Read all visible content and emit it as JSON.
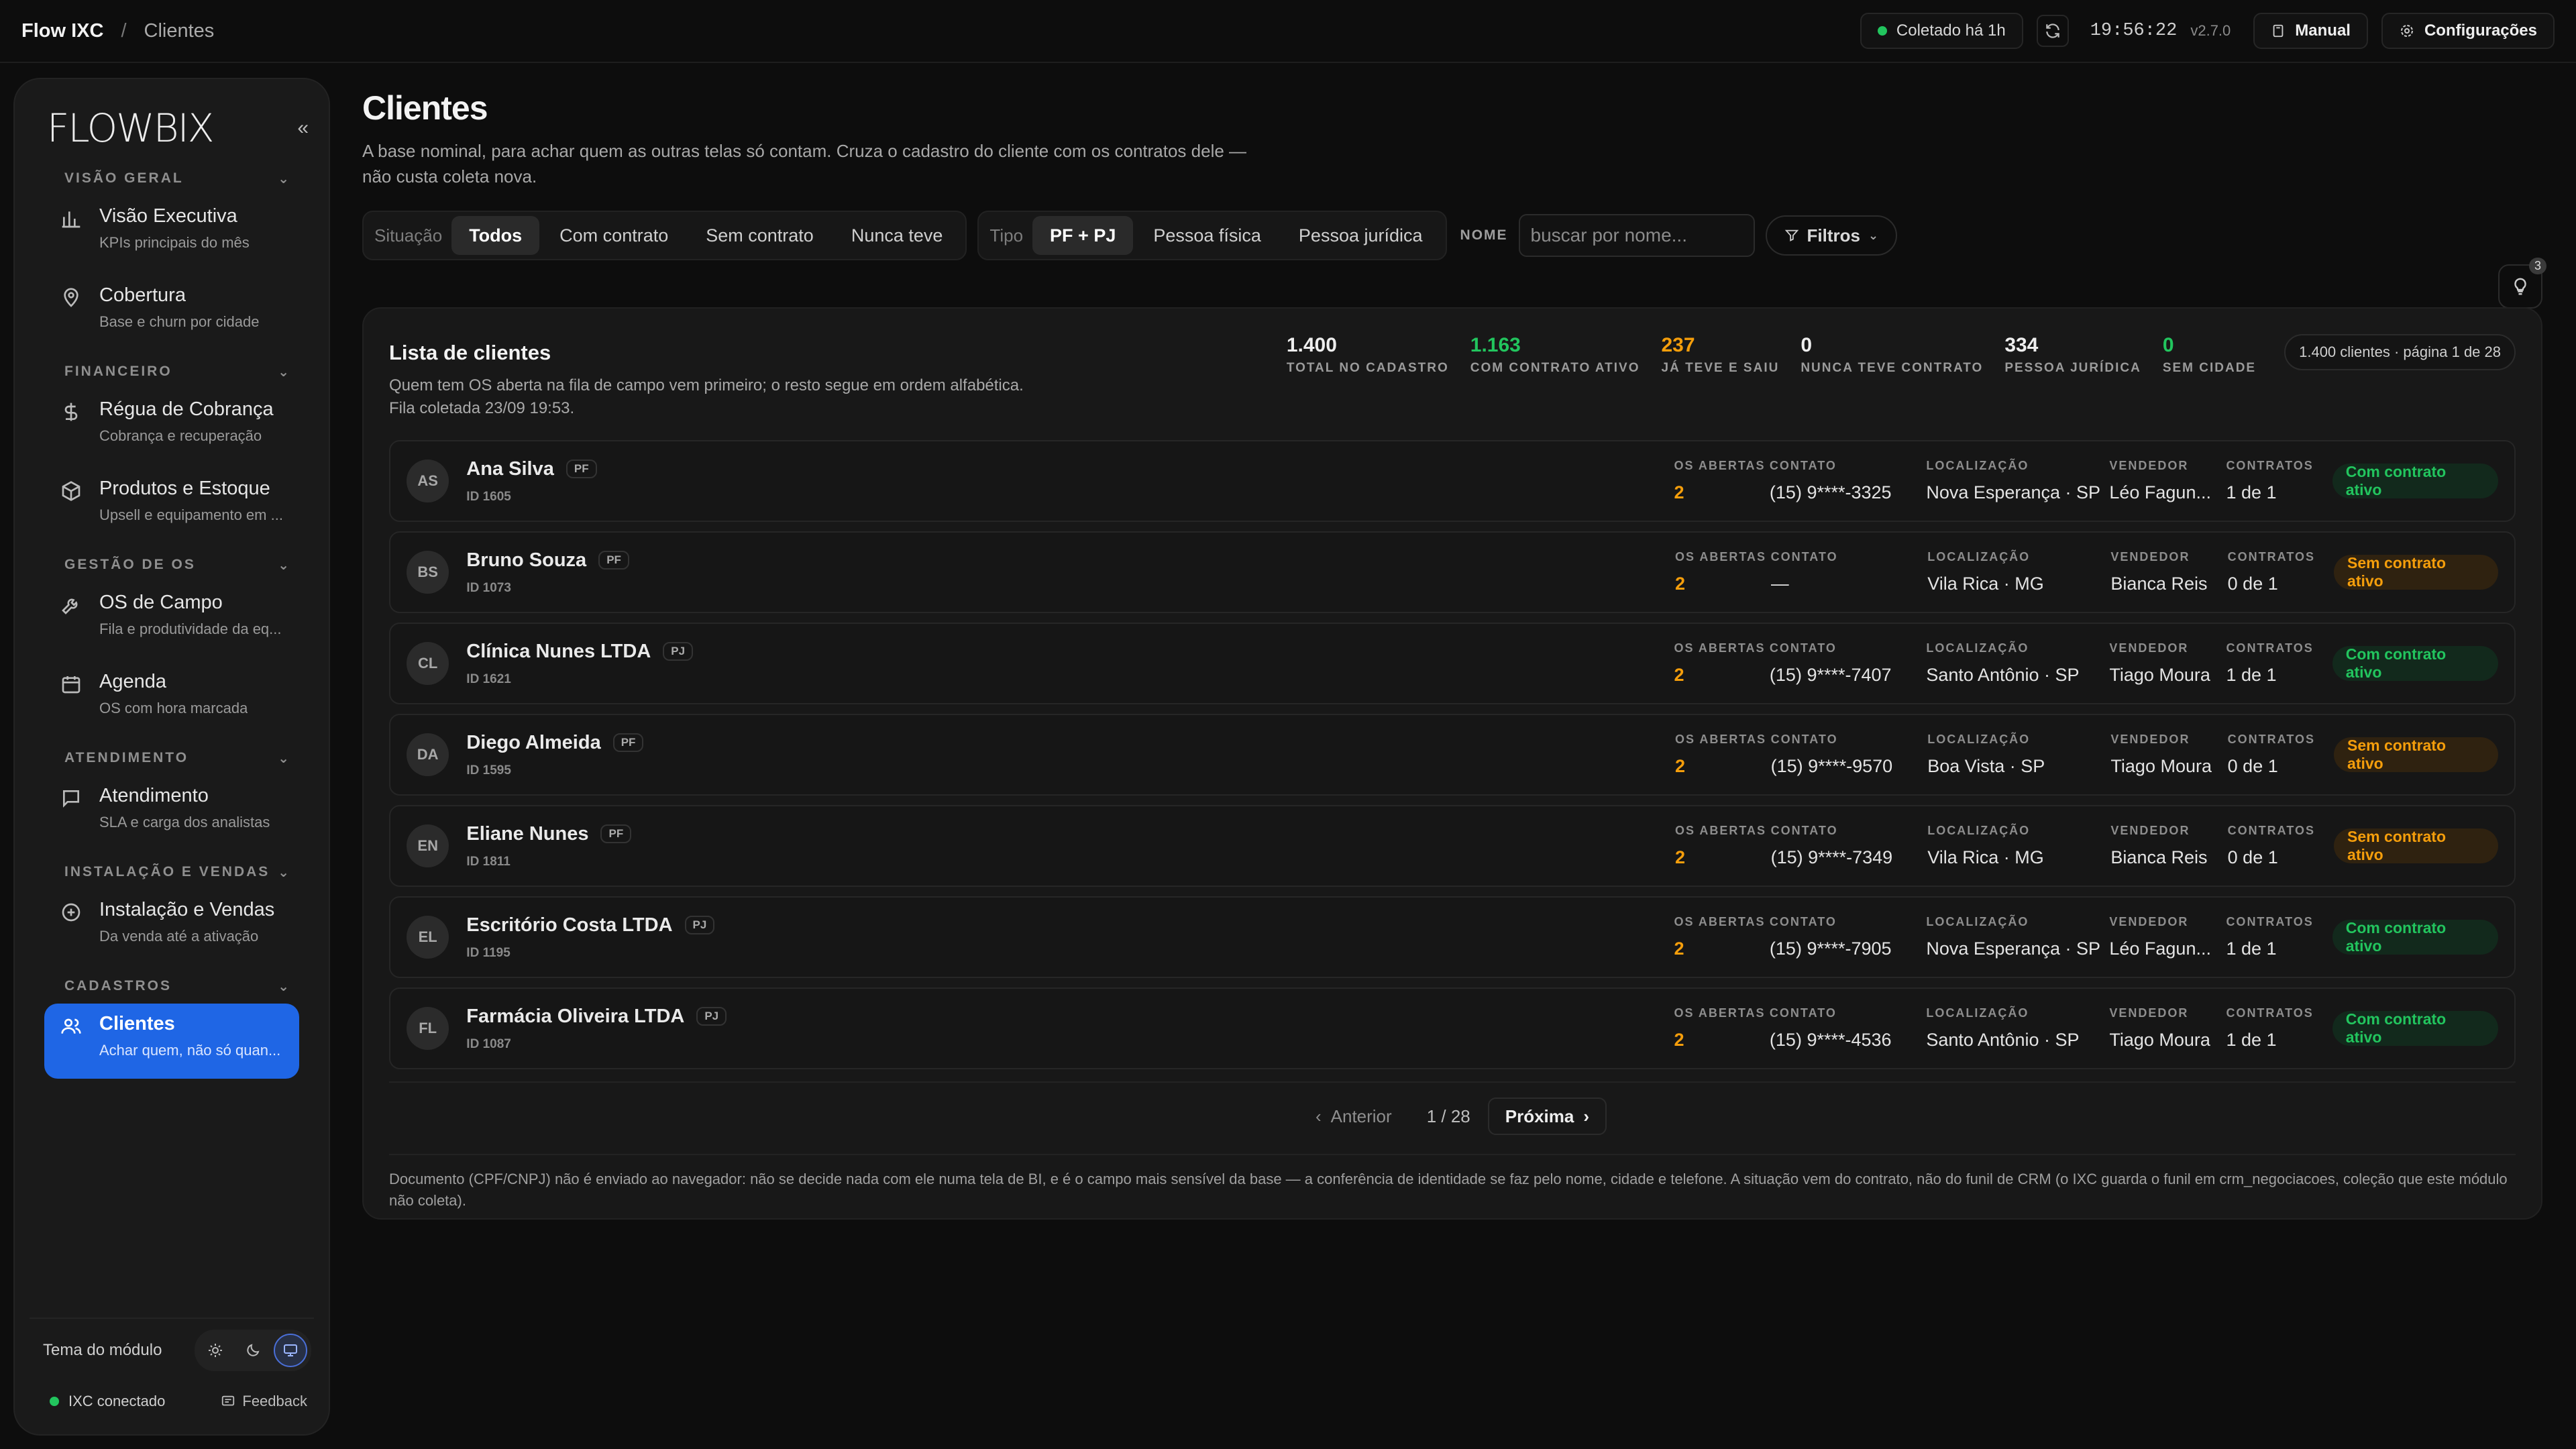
{
  "topbar": {
    "app": "Flow IXC",
    "separator": "/",
    "page": "Clientes",
    "collected": "Coletado há 1h",
    "clock": "19:56:22",
    "version": "v2.7.0",
    "manual": "Manual",
    "settings": "Configurações"
  },
  "sidebar": {
    "logo": "FLOWBIX",
    "collapse_icon": "double-chevron-left-icon",
    "sections": [
      {
        "title": "VISÃO GERAL",
        "items": [
          {
            "label": "Visão Executiva",
            "sub": "KPIs principais do mês",
            "icon": "bar-chart-icon"
          },
          {
            "label": "Cobertura",
            "sub": "Base e churn por cidade",
            "icon": "map-pin-icon"
          }
        ]
      },
      {
        "title": "FINANCEIRO",
        "items": [
          {
            "label": "Régua de Cobrança",
            "sub": "Cobrança e recuperação",
            "icon": "dollar-icon"
          },
          {
            "label": "Produtos e Estoque",
            "sub": "Upsell e equipamento em ...",
            "icon": "box-icon"
          }
        ]
      },
      {
        "title": "GESTÃO DE OS",
        "items": [
          {
            "label": "OS de Campo",
            "sub": "Fila e produtividade da eq...",
            "icon": "wrench-icon"
          },
          {
            "label": "Agenda",
            "sub": "OS com hora marcada",
            "icon": "calendar-icon"
          }
        ]
      },
      {
        "title": "ATENDIMENTO",
        "items": [
          {
            "label": "Atendimento",
            "sub": "SLA e carga dos analistas",
            "icon": "chat-icon"
          }
        ]
      },
      {
        "title": "INSTALAÇÃO E VENDAS",
        "items": [
          {
            "label": "Instalação e Vendas",
            "sub": "Da venda até a ativação",
            "icon": "plus-circle-icon"
          }
        ]
      },
      {
        "title": "CADASTROS",
        "items": [
          {
            "label": "Clientes",
            "sub": "Achar quem, não só quan...",
            "icon": "users-icon",
            "active": true
          }
        ]
      }
    ],
    "theme_label": "Tema do módulo",
    "connection": "IXC conectado",
    "feedback": "Feedback"
  },
  "main": {
    "title": "Clientes",
    "description": "A base nominal, para achar quem as outras telas só contam. Cruza o cadastro do cliente com os contratos dele — não custa coleta nova.",
    "situacao_label": "Situação",
    "situacao_options": [
      "Todos",
      "Com contrato",
      "Sem contrato",
      "Nunca teve"
    ],
    "situacao_selected": "Todos",
    "tipo_label": "Tipo",
    "tipo_options": [
      "PF + PJ",
      "Pessoa física",
      "Pessoa jurídica"
    ],
    "tipo_selected": "PF + PJ",
    "name_label": "NOME",
    "search_placeholder": "buscar por nome...",
    "filters_label": "Filtros",
    "tips_count": "3"
  },
  "card": {
    "title": "Lista de clientes",
    "subtitle_1": "Quem tem OS aberta na fila de campo vem primeiro; o resto segue em ordem alfabética.",
    "subtitle_2": "Fila coletada 23/09 19:53.",
    "kpis": [
      {
        "value": "1.400",
        "label": "TOTAL NO CADASTRO",
        "color": "#eeeeee"
      },
      {
        "value": "1.163",
        "label": "COM CONTRATO ATIVO",
        "color": "#22c55e"
      },
      {
        "value": "237",
        "label": "JÁ TEVE E SAIU",
        "color": "#f59e0b"
      },
      {
        "value": "0",
        "label": "NUNCA TEVE CONTRATO",
        "color": "#eeeeee"
      },
      {
        "value": "334",
        "label": "PESSOA JURÍDICA",
        "color": "#eeeeee"
      },
      {
        "value": "0",
        "label": "SEM CIDADE",
        "color": "#22c55e"
      }
    ],
    "page_info": "1.400 clientes · página 1 de 28",
    "col_headers": {
      "os": "OS ABERTAS",
      "contact": "CONTATO",
      "location": "LOCALIZAÇÃO",
      "seller": "VENDEDOR",
      "contracts": "CONTRATOS"
    },
    "rows": [
      {
        "initials": "AS",
        "name": "Ana Silva",
        "type": "PF",
        "id": "ID 1605",
        "os": "2",
        "contact": "(15) 9****-3325",
        "location": "Nova Esperança · SP",
        "seller": "Léo Fagun...",
        "contracts": "1 de 1",
        "status": "Com contrato ativo",
        "ok": true
      },
      {
        "initials": "BS",
        "name": "Bruno Souza",
        "type": "PF",
        "id": "ID 1073",
        "os": "2",
        "contact": "—",
        "location": "Vila Rica · MG",
        "seller": "Bianca Reis",
        "contracts": "0 de 1",
        "status": "Sem contrato ativo",
        "ok": false
      },
      {
        "initials": "CL",
        "name": "Clínica Nunes LTDA",
        "type": "PJ",
        "id": "ID 1621",
        "os": "2",
        "contact": "(15) 9****-7407",
        "location": "Santo Antônio · SP",
        "seller": "Tiago Moura",
        "contracts": "1 de 1",
        "status": "Com contrato ativo",
        "ok": true
      },
      {
        "initials": "DA",
        "name": "Diego Almeida",
        "type": "PF",
        "id": "ID 1595",
        "os": "2",
        "contact": "(15) 9****-9570",
        "location": "Boa Vista · SP",
        "seller": "Tiago Moura",
        "contracts": "0 de 1",
        "status": "Sem contrato ativo",
        "ok": false
      },
      {
        "initials": "EN",
        "name": "Eliane Nunes",
        "type": "PF",
        "id": "ID 1811",
        "os": "2",
        "contact": "(15) 9****-7349",
        "location": "Vila Rica · MG",
        "seller": "Bianca Reis",
        "contracts": "0 de 1",
        "status": "Sem contrato ativo",
        "ok": false
      },
      {
        "initials": "EL",
        "name": "Escritório Costa LTDA",
        "type": "PJ",
        "id": "ID 1195",
        "os": "2",
        "contact": "(15) 9****-7905",
        "location": "Nova Esperança · SP",
        "seller": "Léo Fagun...",
        "contracts": "1 de 1",
        "status": "Com contrato ativo",
        "ok": true
      },
      {
        "initials": "FL",
        "name": "Farmácia Oliveira LTDA",
        "type": "PJ",
        "id": "ID 1087",
        "os": "2",
        "contact": "(15) 9****-4536",
        "location": "Santo Antônio · SP",
        "seller": "Tiago Moura",
        "contracts": "1 de 1",
        "status": "Com contrato ativo",
        "ok": true
      }
    ],
    "pager": {
      "prev": "Anterior",
      "count": "1 / 28",
      "next": "Próxima"
    },
    "footnote": "Documento (CPF/CNPJ) não é enviado ao navegador: não se decide nada com ele numa tela de BI, e é o campo mais sensível da base — a conferência de identidade se faz pelo nome, cidade e telefone. A situação vem do contrato, não do funil de CRM (o IXC guarda o funil em crm_negociacoes, coleção que este módulo não coleta)."
  }
}
